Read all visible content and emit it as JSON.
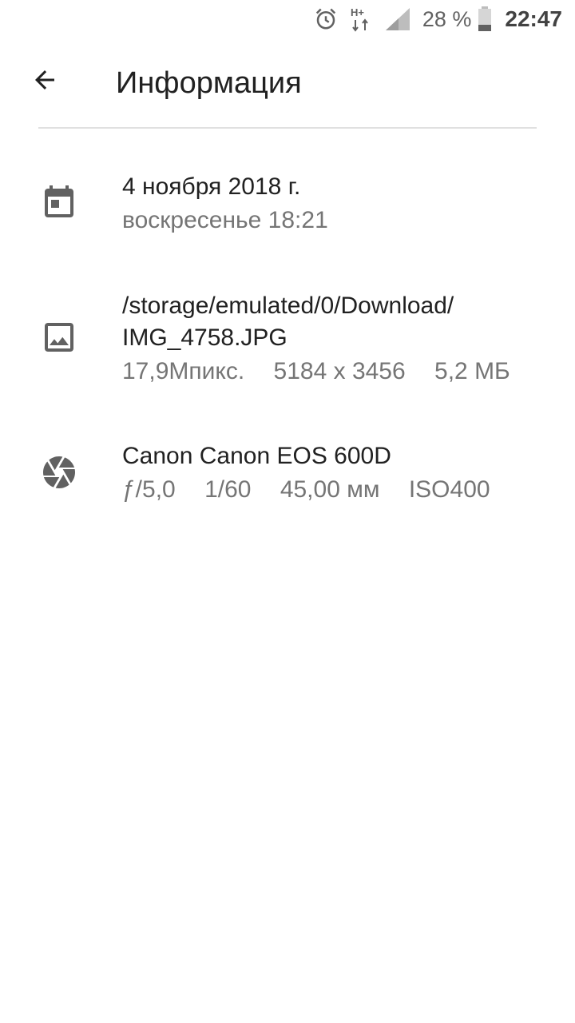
{
  "status_bar": {
    "alarm_icon": "alarm-clock-icon",
    "network_label": "H+",
    "signal_icon": "cell-signal-icon",
    "battery_percent": "28 %",
    "battery_icon": "battery-icon",
    "battery_level": 0.28,
    "time": "22:47"
  },
  "app_bar": {
    "back_icon": "arrow-back-icon",
    "title": "Информация"
  },
  "rows": [
    {
      "icon": "calendar-icon",
      "primary": "4 ноября 2018 г.",
      "secondary": "воскресенье 18:21"
    },
    {
      "icon": "image-icon",
      "primary_line1": "/storage/emulated/0/Download/",
      "primary_line2": "IMG_4758.JPG",
      "meta": [
        "17,9Мпикс.",
        "5184 x 3456",
        "5,2 МБ"
      ]
    },
    {
      "icon": "camera-aperture-icon",
      "primary": "Canon Canon EOS 600D",
      "meta": [
        "ƒ/5,0",
        "1/60",
        "45,00 мм",
        "ISO400"
      ]
    }
  ],
  "colors": {
    "icon": "#616161",
    "primary_text": "#212121",
    "secondary_text": "#757575",
    "divider": "#e0e0e0"
  }
}
